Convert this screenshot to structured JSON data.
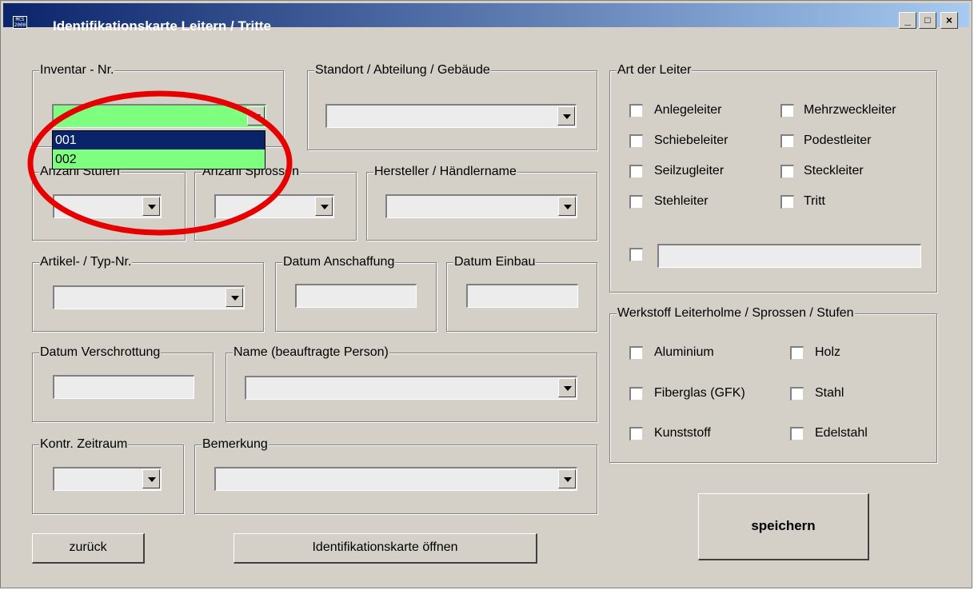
{
  "window": {
    "title": "Identifikationskarte Leitern / Tritte",
    "app_icon_text": "MCS 2000",
    "controls": [
      "minimize",
      "maximize",
      "close"
    ]
  },
  "inventar": {
    "label": "Inventar - Nr.",
    "selected": "",
    "options": [
      "001",
      "002"
    ],
    "highlighted_index": 0,
    "background": "#7fff7f"
  },
  "standort": {
    "label": "Standort / Abteilung / Gebäude",
    "value": ""
  },
  "anzahl_stufen": {
    "label": "Anzahl Stufen",
    "value": ""
  },
  "anzahl_sprossen": {
    "label": "Anzahl Sprossen",
    "value": ""
  },
  "hersteller": {
    "label": "Hersteller / Händlername",
    "value": ""
  },
  "artikel": {
    "label": "Artikel- / Typ-Nr.",
    "value": ""
  },
  "datum_anschaffung": {
    "label": "Datum Anschaffung",
    "value": ""
  },
  "datum_einbau": {
    "label": "Datum Einbau",
    "value": ""
  },
  "datum_verschrottung": {
    "label": "Datum Verschrottung",
    "value": ""
  },
  "name": {
    "label": "Name (beauftragte Person)",
    "value": ""
  },
  "kontr_zeitraum": {
    "label": "Kontr. Zeitraum",
    "value": ""
  },
  "bemerkung": {
    "label": "Bemerkung",
    "value": ""
  },
  "art_der_leiter": {
    "label": "Art der Leiter",
    "options": [
      {
        "label": "Anlegeleiter",
        "checked": false
      },
      {
        "label": "Mehrzweckleiter",
        "checked": false
      },
      {
        "label": "Schiebeleiter",
        "checked": false
      },
      {
        "label": "Podestleiter",
        "checked": false
      },
      {
        "label": "Seilzugleiter",
        "checked": false
      },
      {
        "label": "Steckleiter",
        "checked": false
      },
      {
        "label": "Stehleiter",
        "checked": false
      },
      {
        "label": "Tritt",
        "checked": false
      }
    ],
    "other_checked": false,
    "other_value": ""
  },
  "werkstoff": {
    "label": "Werkstoff Leiterholme / Sprossen / Stufen",
    "options": [
      {
        "label": "Aluminium",
        "checked": false
      },
      {
        "label": "Holz",
        "checked": false
      },
      {
        "label": "Fiberglas (GFK)",
        "checked": false
      },
      {
        "label": "Stahl",
        "checked": false
      },
      {
        "label": "Kunststoff",
        "checked": false
      },
      {
        "label": "Edelstahl",
        "checked": false
      }
    ]
  },
  "buttons": {
    "save": "speichern",
    "back": "zurück",
    "open_card": "Identifikationskarte öffnen"
  },
  "annotation": {
    "shape": "ellipse",
    "color": "#e60000"
  }
}
